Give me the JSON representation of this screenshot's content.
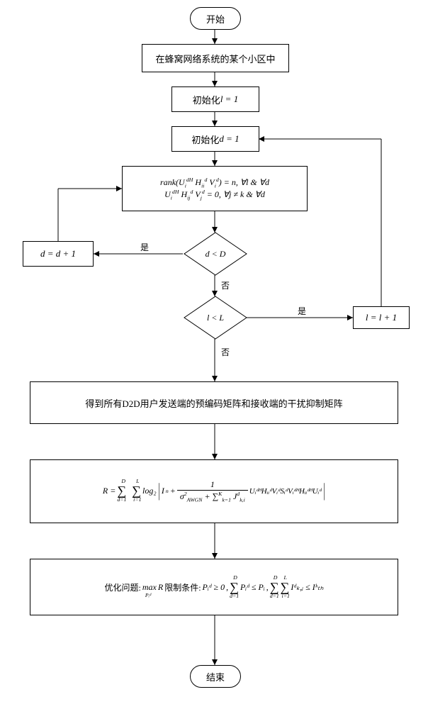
{
  "terminator": {
    "start": "开始",
    "end": "结束"
  },
  "step1": "在蜂窝网络系统的某个小区中",
  "step2_prefix": "初始化 ",
  "step2_eq": "l = 1",
  "step3_prefix": "初始化 ",
  "step3_eq": "d = 1",
  "rank_line1_a": "rank(U",
  "rank_line1_sub1": "i",
  "rank_line1_sup1": "dH",
  "rank_line1_b": " H",
  "rank_line1_sub2": "ii",
  "rank_line1_sup2": "d",
  "rank_line1_c": " V",
  "rank_line1_sub3": "i",
  "rank_line1_sup3": "d",
  "rank_line1_d": ") = n, ∀l & ∀d",
  "rank_line2_a": "U",
  "rank_line2_b": " H",
  "rank_line2_sub2": "ij",
  "rank_line2_c": " V",
  "rank_line2_sub3": "j",
  "rank_line2_d": " = 0, ∀j ≠ k & ∀d",
  "dec1": "d < D",
  "dec2": "l < L",
  "inc_d": "d = d + 1",
  "inc_l": "l = l + 1",
  "yes": "是",
  "no": "否",
  "result1": "得到所有D2D用户发送端的预编码矩阵和接收端的干扰抑制矩阵",
  "R_lead": "R = ",
  "R_sum1": "∑",
  "R_sum1_lo": "d=1",
  "R_sum1_hi": "D",
  "R_sum2_lo": "i=1",
  "R_sum2_hi": "L",
  "R_log": " log₂ ",
  "R_tail_a": "I",
  "R_tail_a_sub": "n",
  "R_tail_plus": " + ",
  "R_frac_num": "1",
  "R_sigma": "σ",
  "R_sigma_sub": "AWGN",
  "R_sigma_sup": "2",
  "R_sumK": " + ∑",
  "R_sumK_lo": "k=1",
  "R_sumK_hi": "K",
  "R_J": " J",
  "R_J_sub": "k,i",
  "R_J_sup": "d",
  "R_matrices": " UᵢᵈᴴHᵢᵢᵈVᵢᵈSᵢᵈVᵢᵈᴴHᵢᵢᵈᴴUᵢᵈ",
  "opt_label": "优化问题: ",
  "opt_max": "max",
  "opt_max_sub": "Pᵢᵈ",
  "opt_R": " R ",
  "cond_label": " 限制条件: ",
  "cond_1": "Pᵢᵈ ≥ 0",
  "cond_sep": ", ",
  "cond_2a": "∑",
  "cond_2b": " Pᵢᵈ ≤ Pᵢ",
  "cond_3a": "∑",
  "cond_3b": " ∑",
  "cond_3c": " Iᵈₖ,ᵢ ≤ Iᵏₜₕ"
}
